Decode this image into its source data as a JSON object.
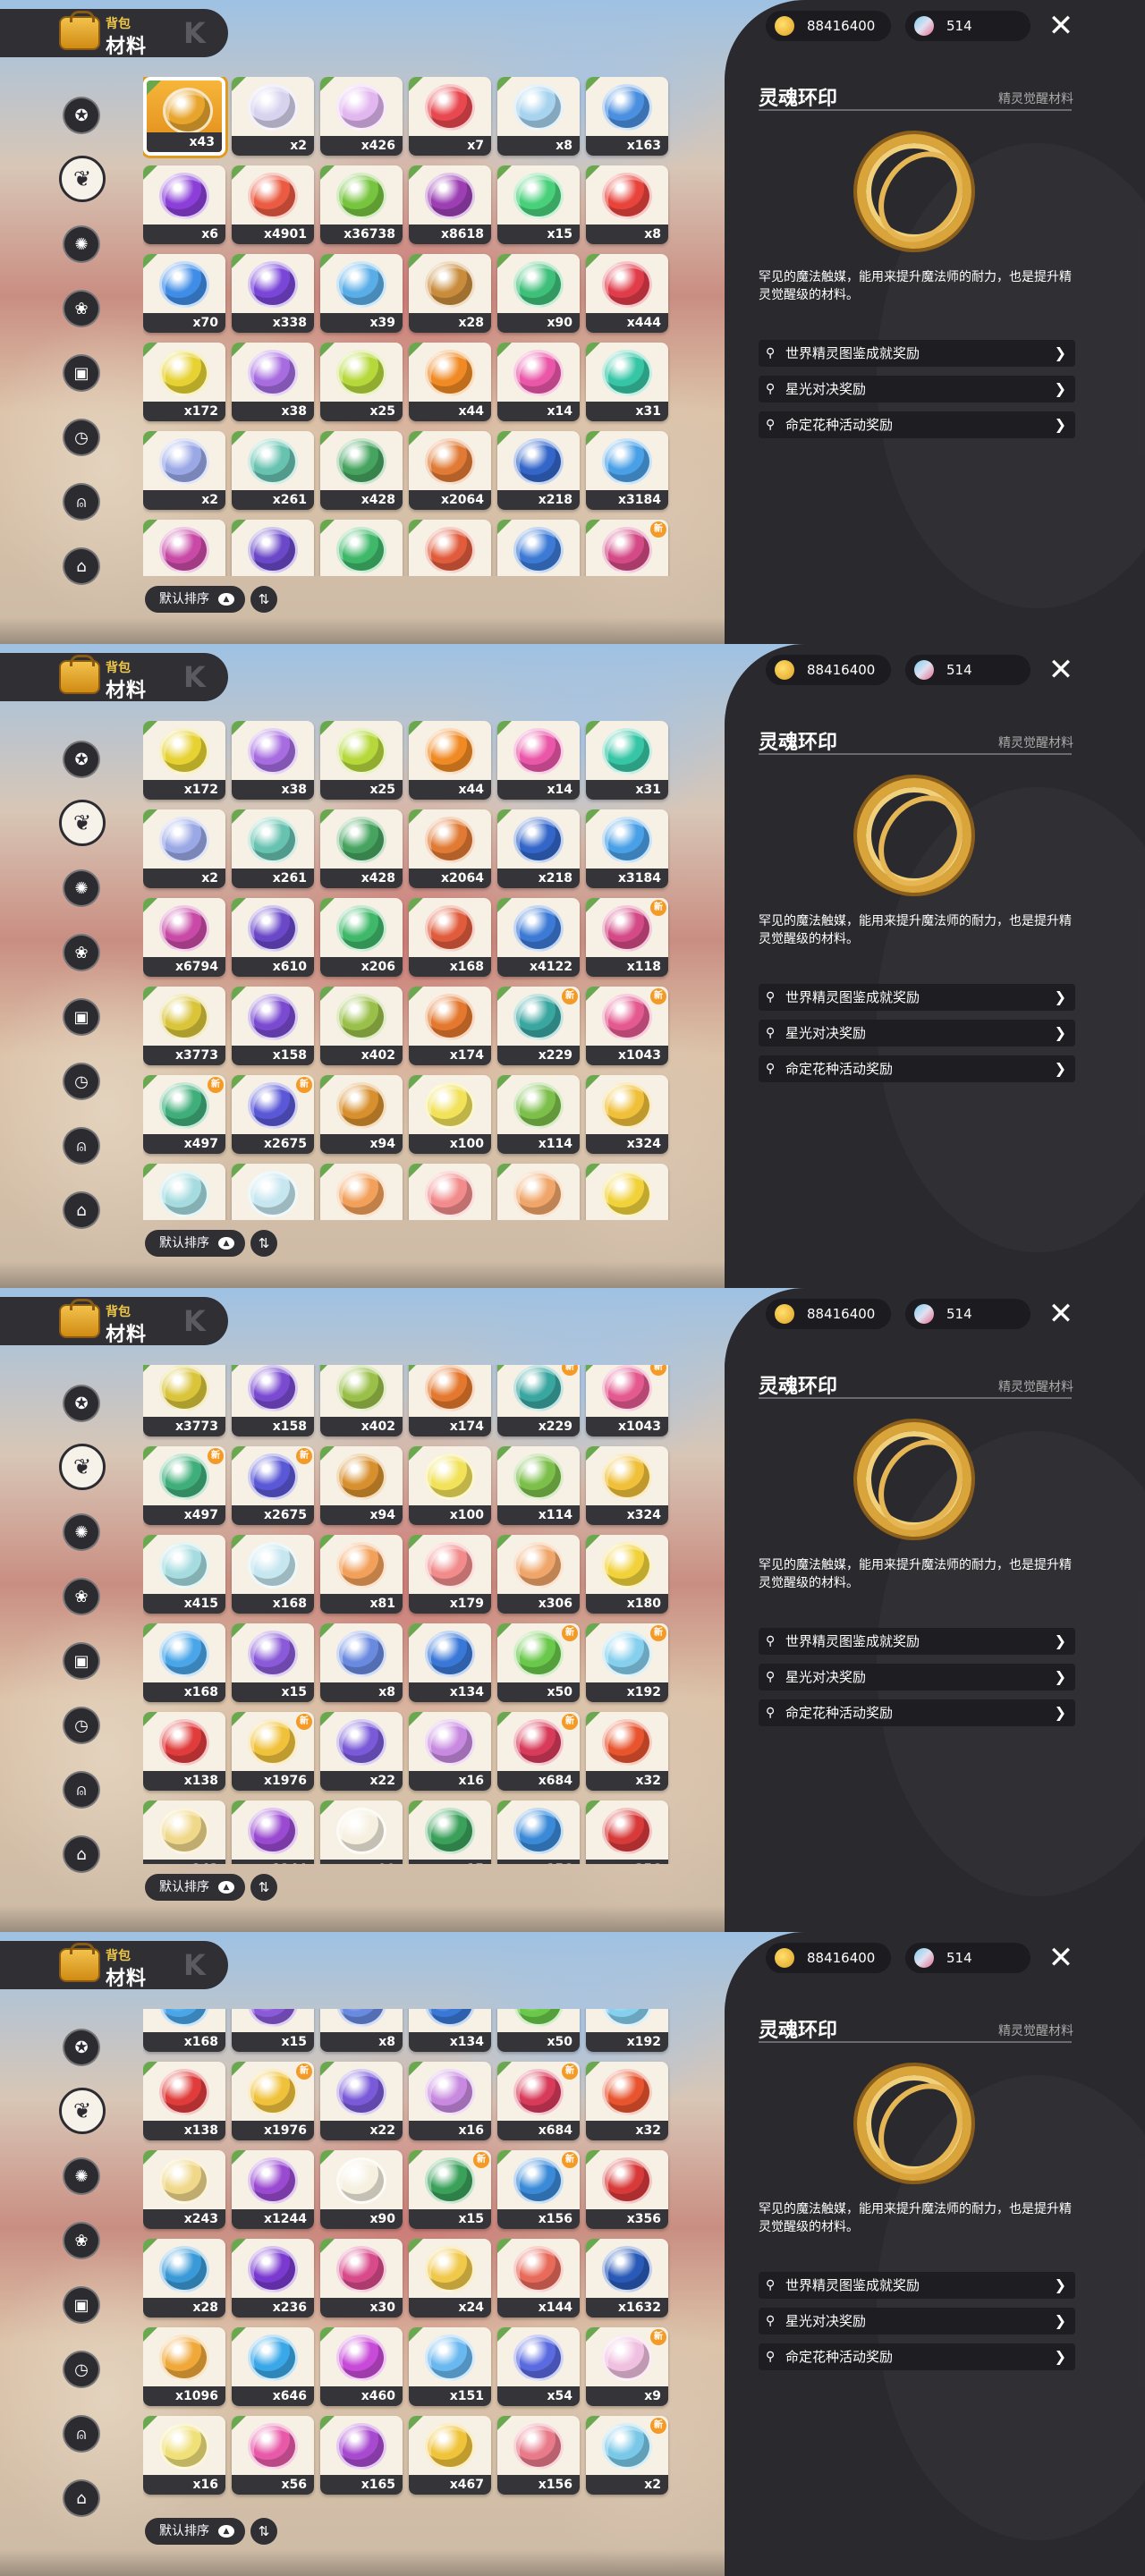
{
  "header": {
    "sub": "背包",
    "main": "材料"
  },
  "resources": {
    "coins": "88416400",
    "gems": "514"
  },
  "sort": {
    "label": "默认排序"
  },
  "detail": {
    "name": "灵魂环印",
    "category": "精灵觉醒材料",
    "description": "罕见的魔法触媒，能用来提升魔法师的耐力，也是提升精灵觉醒级的材料。",
    "sources": [
      "世界精灵图鉴成就奖励",
      "星光对决奖励",
      "命定花种活动奖励"
    ]
  },
  "icons": [
    "star-icon",
    "leaf-icon",
    "badge-icon",
    "sprout-icon",
    "gift-icon",
    "clock-icon",
    "bell-icon",
    "chest-icon"
  ],
  "colors": {
    "panel": "#2a2a2e",
    "accent": "#e09a1c",
    "count_bar": "#353539",
    "selected": "#f6b63a"
  },
  "screens": [
    {
      "rows": [
        [
          {
            "n": "x43",
            "c": "#e8a52e"
          },
          {
            "n": "x2",
            "c": "#d7d2ee"
          },
          {
            "n": "x426",
            "c": "#e2b7f0"
          },
          {
            "n": "x7",
            "c": "#e8484f"
          },
          {
            "n": "x8",
            "c": "#a7d3ef"
          },
          {
            "n": "x163",
            "c": "#4a8fe0"
          }
        ],
        [
          {
            "n": "x6",
            "c": "#8b3fd8"
          },
          {
            "n": "x4901",
            "c": "#ea5b42"
          },
          {
            "n": "x36738",
            "c": "#77c43f"
          },
          {
            "n": "x8618",
            "c": "#9c3fb3"
          },
          {
            "n": "x15",
            "c": "#48d07a"
          },
          {
            "n": "x8",
            "c": "#e8443c"
          }
        ],
        [
          {
            "n": "x70",
            "c": "#3f8de6"
          },
          {
            "n": "x338",
            "c": "#7a46d8"
          },
          {
            "n": "x39",
            "c": "#5aaee8"
          },
          {
            "n": "x28",
            "c": "#c98c3c"
          },
          {
            "n": "x90",
            "c": "#3fc07a"
          },
          {
            "n": "x444",
            "c": "#e03c4a"
          }
        ],
        [
          {
            "n": "x172",
            "c": "#e7d233"
          },
          {
            "n": "x38",
            "c": "#a66ce0"
          },
          {
            "n": "x25",
            "c": "#b6d83a"
          },
          {
            "n": "x44",
            "c": "#f08a24"
          },
          {
            "n": "x14",
            "c": "#ea57a8"
          },
          {
            "n": "x31",
            "c": "#36c6a6"
          }
        ],
        [
          {
            "n": "x2",
            "c": "#9aa8e6"
          },
          {
            "n": "x261",
            "c": "#67c2b0"
          },
          {
            "n": "x428",
            "c": "#47a460"
          },
          {
            "n": "x2064",
            "c": "#e07a34"
          },
          {
            "n": "x218",
            "c": "#3366c8"
          },
          {
            "n": "x3184",
            "c": "#4aa0e6"
          }
        ],
        [
          {
            "n": "",
            "c": "#c84aa6"
          },
          {
            "n": "",
            "c": "#6a48c8"
          },
          {
            "n": "",
            "c": "#3fb86a"
          },
          {
            "n": "",
            "c": "#e05c3c"
          },
          {
            "n": "",
            "c": "#3c7ad6"
          },
          {
            "n": "",
            "c": "#d44a86",
            "new": "新"
          }
        ]
      ]
    },
    {
      "rows": [
        [
          {
            "n": "x172",
            "c": "#e7d233"
          },
          {
            "n": "x38",
            "c": "#a66ce0"
          },
          {
            "n": "x25",
            "c": "#b6d83a"
          },
          {
            "n": "x44",
            "c": "#f08a24"
          },
          {
            "n": "x14",
            "c": "#ea57a8"
          },
          {
            "n": "x31",
            "c": "#36c6a6"
          }
        ],
        [
          {
            "n": "x2",
            "c": "#9aa8e6"
          },
          {
            "n": "x261",
            "c": "#67c2b0"
          },
          {
            "n": "x428",
            "c": "#47a460"
          },
          {
            "n": "x2064",
            "c": "#e07a34"
          },
          {
            "n": "x218",
            "c": "#3366c8"
          },
          {
            "n": "x3184",
            "c": "#4aa0e6"
          }
        ],
        [
          {
            "n": "x6794",
            "c": "#c84aa6"
          },
          {
            "n": "x610",
            "c": "#6a48c8"
          },
          {
            "n": "x206",
            "c": "#3fb86a"
          },
          {
            "n": "x168",
            "c": "#e05c3c"
          },
          {
            "n": "x4122",
            "c": "#3c7ad6"
          },
          {
            "n": "x118",
            "c": "#d44a86",
            "new": "新"
          }
        ],
        [
          {
            "n": "x3773",
            "c": "#d9c43a"
          },
          {
            "n": "x158",
            "c": "#7a4ad0"
          },
          {
            "n": "x402",
            "c": "#9ac04a"
          },
          {
            "n": "x174",
            "c": "#e4782e"
          },
          {
            "n": "x229",
            "c": "#3aa6a0",
            "new": "新"
          },
          {
            "n": "x1043",
            "c": "#e45a90",
            "new": "新"
          }
        ],
        [
          {
            "n": "x497",
            "c": "#3fae7a",
            "new": "新"
          },
          {
            "n": "x2675",
            "c": "#5a58d6",
            "new": "新"
          },
          {
            "n": "x94",
            "c": "#d8902e"
          },
          {
            "n": "x100",
            "c": "#f1e25a"
          },
          {
            "n": "x114",
            "c": "#7cbf4a"
          },
          {
            "n": "x324",
            "c": "#f0c03a"
          }
        ],
        [
          {
            "n": "",
            "c": "#a6dce0"
          },
          {
            "n": "",
            "c": "#c6e6f0"
          },
          {
            "n": "",
            "c": "#f2a05a"
          },
          {
            "n": "",
            "c": "#f28c8c"
          },
          {
            "n": "",
            "c": "#f0a66a"
          },
          {
            "n": "",
            "c": "#f2d23a"
          }
        ]
      ]
    },
    {
      "rows": [
        [
          {
            "n": "x3773",
            "c": "#d9c43a"
          },
          {
            "n": "x158",
            "c": "#7a4ad0"
          },
          {
            "n": "x402",
            "c": "#9ac04a"
          },
          {
            "n": "x174",
            "c": "#e4782e"
          },
          {
            "n": "x229",
            "c": "#3aa6a0",
            "new": "新"
          },
          {
            "n": "x1043",
            "c": "#e45a90",
            "new": "新"
          }
        ],
        [
          {
            "n": "x497",
            "c": "#3fae7a",
            "new": "新"
          },
          {
            "n": "x2675",
            "c": "#5a58d6",
            "new": "新"
          },
          {
            "n": "x94",
            "c": "#d8902e"
          },
          {
            "n": "x100",
            "c": "#f1e25a"
          },
          {
            "n": "x114",
            "c": "#7cbf4a"
          },
          {
            "n": "x324",
            "c": "#f0c03a"
          }
        ],
        [
          {
            "n": "x415",
            "c": "#a6dce0"
          },
          {
            "n": "x168",
            "c": "#c6e6f0"
          },
          {
            "n": "x81",
            "c": "#f2a05a"
          },
          {
            "n": "x179",
            "c": "#f28c8c"
          },
          {
            "n": "x306",
            "c": "#f0a66a"
          },
          {
            "n": "x180",
            "c": "#f2d23a"
          }
        ],
        [
          {
            "n": "x168",
            "c": "#4aa6e8"
          },
          {
            "n": "x15",
            "c": "#8a5ad8"
          },
          {
            "n": "x8",
            "c": "#6a8ae0"
          },
          {
            "n": "x134",
            "c": "#3a78d8"
          },
          {
            "n": "x50",
            "c": "#6ac84a",
            "new": "新"
          },
          {
            "n": "x192",
            "c": "#86d0ee",
            "new": "新"
          }
        ],
        [
          {
            "n": "x138",
            "c": "#e03c3c"
          },
          {
            "n": "x1976",
            "c": "#f0c23c",
            "new": "新"
          },
          {
            "n": "x22",
            "c": "#7a5ad8"
          },
          {
            "n": "x16",
            "c": "#c88ae0"
          },
          {
            "n": "x684",
            "c": "#d83a5a",
            "new": "新"
          },
          {
            "n": "x32",
            "c": "#e8542e"
          }
        ],
        [
          {
            "n": "x243",
            "c": "#f0d88a"
          },
          {
            "n": "x1244",
            "c": "#9a4ad0"
          },
          {
            "n": "x90",
            "c": "#f6f0e0"
          },
          {
            "n": "x15",
            "c": "#3aa05a"
          },
          {
            "n": "x156",
            "c": "#3a8ad8"
          },
          {
            "n": "x356",
            "c": "#d83a3a"
          }
        ]
      ]
    },
    {
      "rows": [
        [
          {
            "n": "x168",
            "c": "#4aa6e8"
          },
          {
            "n": "x15",
            "c": "#8a5ad8"
          },
          {
            "n": "x8",
            "c": "#6a8ae0"
          },
          {
            "n": "x134",
            "c": "#3a78d8"
          },
          {
            "n": "x50",
            "c": "#6ac84a",
            "new": "新"
          },
          {
            "n": "x192",
            "c": "#86d0ee",
            "new": "新"
          }
        ],
        [
          {
            "n": "x138",
            "c": "#e03c3c"
          },
          {
            "n": "x1976",
            "c": "#f0c23c",
            "new": "新"
          },
          {
            "n": "x22",
            "c": "#7a5ad8"
          },
          {
            "n": "x16",
            "c": "#c88ae0"
          },
          {
            "n": "x684",
            "c": "#d83a5a",
            "new": "新"
          },
          {
            "n": "x32",
            "c": "#e8542e"
          }
        ],
        [
          {
            "n": "x243",
            "c": "#f0d88a"
          },
          {
            "n": "x1244",
            "c": "#9a4ad0"
          },
          {
            "n": "x90",
            "c": "#f6f0e0"
          },
          {
            "n": "x15",
            "c": "#3aa05a",
            "new": "新"
          },
          {
            "n": "x156",
            "c": "#3a8ad8",
            "new": "新"
          },
          {
            "n": "x356",
            "c": "#d83a3a"
          }
        ],
        [
          {
            "n": "x28",
            "c": "#3a9ad8"
          },
          {
            "n": "x236",
            "c": "#7a3ad0"
          },
          {
            "n": "x30",
            "c": "#d84a8a"
          },
          {
            "n": "x24",
            "c": "#f0c84a"
          },
          {
            "n": "x144",
            "c": "#e86a5a"
          },
          {
            "n": "x1632",
            "c": "#2a5ab8"
          }
        ],
        [
          {
            "n": "x1096",
            "c": "#f0a83a"
          },
          {
            "n": "x646",
            "c": "#3aa8e8"
          },
          {
            "n": "x460",
            "c": "#c84ad8"
          },
          {
            "n": "x151",
            "c": "#6ab8f0"
          },
          {
            "n": "x54",
            "c": "#5a6ae0"
          },
          {
            "n": "x9",
            "c": "#f0c0e0",
            "new": "新"
          }
        ],
        [
          {
            "n": "x16",
            "c": "#f0e07a"
          },
          {
            "n": "x56",
            "c": "#e85aa8"
          },
          {
            "n": "x165",
            "c": "#a84ad0"
          },
          {
            "n": "x467",
            "c": "#f0c43a"
          },
          {
            "n": "x156",
            "c": "#e87a8a"
          },
          {
            "n": "x2",
            "c": "#7ac8e8",
            "new": "新"
          }
        ]
      ]
    }
  ]
}
